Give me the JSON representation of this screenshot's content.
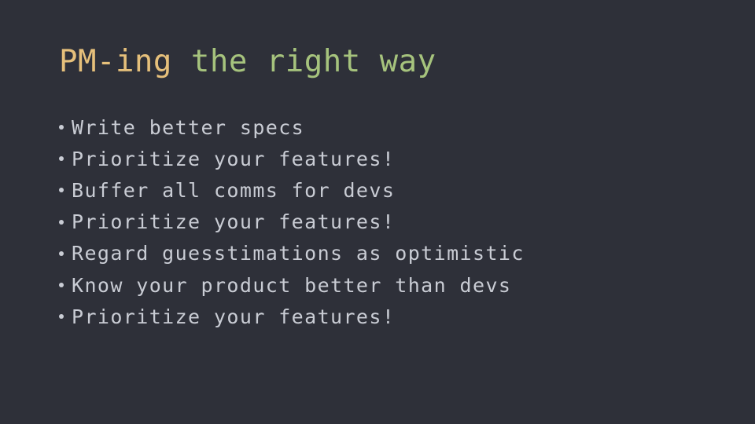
{
  "slide": {
    "title_part1": "PM-ing",
    "title_part2": "the right way",
    "colors": {
      "background": "#2e3039",
      "title_accent_1": "#e6c07b",
      "title_accent_2": "#a6c37d",
      "body_text": "#c9ccd4"
    },
    "bullets": [
      "Write better specs",
      "Prioritize your features!",
      "Buffer all comms for devs",
      "Prioritize your features!",
      "Regard guesstimations as optimistic",
      "Know your product better than devs",
      "Prioritize your features!"
    ]
  }
}
